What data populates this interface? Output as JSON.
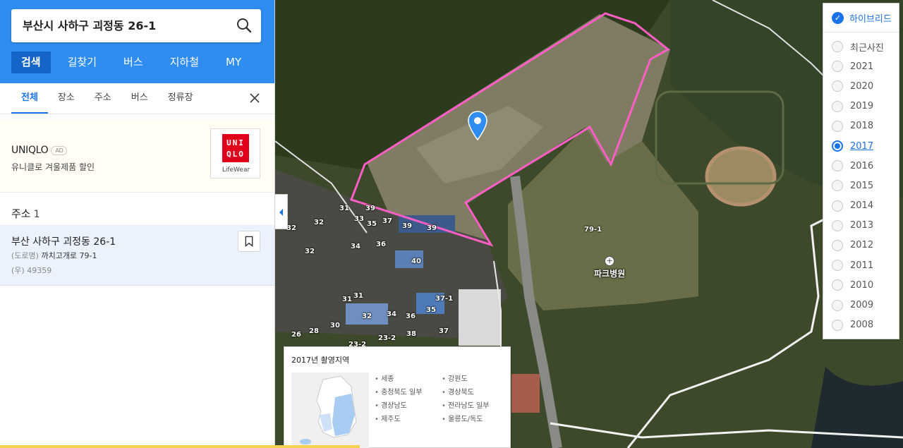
{
  "search": {
    "query": "부산시 사하구 괴정동 26-1"
  },
  "main_tabs": [
    {
      "label": "검색",
      "active": true
    },
    {
      "label": "길찾기",
      "active": false
    },
    {
      "label": "버스",
      "active": false
    },
    {
      "label": "지하철",
      "active": false
    },
    {
      "label": "MY",
      "active": false
    }
  ],
  "filter_tabs": [
    {
      "label": "전체",
      "active": true
    },
    {
      "label": "장소",
      "active": false
    },
    {
      "label": "주소",
      "active": false
    },
    {
      "label": "버스",
      "active": false
    },
    {
      "label": "정류장",
      "active": false
    }
  ],
  "ad": {
    "brand": "UNIQLO",
    "badge": "AD",
    "description": "유니클로 겨울제품 할인",
    "logo_line1": "UNI",
    "logo_line2": "QLO",
    "logo_caption": "LifeWear"
  },
  "address_section": {
    "title": "주소",
    "count": "1"
  },
  "address_result": {
    "main": "부산 사하구 괴정동 26-1",
    "road_tag": "(도로명)",
    "road": "까치고개로 79-1",
    "zip_tag": "(우)",
    "zip": "49359"
  },
  "map": {
    "poi_name": "파크병원",
    "parcel_label": "79-1",
    "lot_numbers": [
      "31",
      "39",
      "33",
      "35",
      "37",
      "39",
      "39",
      "32",
      "32",
      "34",
      "36",
      "40",
      "31",
      "31",
      "37-1",
      "32",
      "34",
      "36",
      "35",
      "30",
      "28",
      "26",
      "23-2",
      "23-2",
      "38",
      "37",
      "32"
    ]
  },
  "year_panel": {
    "hybrid_label": "하이브리드",
    "options": [
      {
        "label": "최근사진",
        "selected": false
      },
      {
        "label": "2021",
        "selected": false
      },
      {
        "label": "2020",
        "selected": false
      },
      {
        "label": "2019",
        "selected": false
      },
      {
        "label": "2018",
        "selected": false
      },
      {
        "label": "2017",
        "selected": true
      },
      {
        "label": "2016",
        "selected": false
      },
      {
        "label": "2015",
        "selected": false
      },
      {
        "label": "2014",
        "selected": false
      },
      {
        "label": "2013",
        "selected": false
      },
      {
        "label": "2012",
        "selected": false
      },
      {
        "label": "2011",
        "selected": false
      },
      {
        "label": "2010",
        "selected": false
      },
      {
        "label": "2009",
        "selected": false
      },
      {
        "label": "2008",
        "selected": false
      }
    ]
  },
  "region_popup": {
    "title": "2017년 촬영지역",
    "regions": [
      "세종",
      "강원도",
      "충청북도 일부",
      "경상북도",
      "경상남도",
      "전라남도 일부",
      "제주도",
      "울릉도/독도"
    ]
  },
  "colors": {
    "accent_blue": "#2f8cf0",
    "selected_blue": "#1a73e8",
    "parcel_outline": "#ff5fc4",
    "uniqlo_red": "#e0001b"
  }
}
